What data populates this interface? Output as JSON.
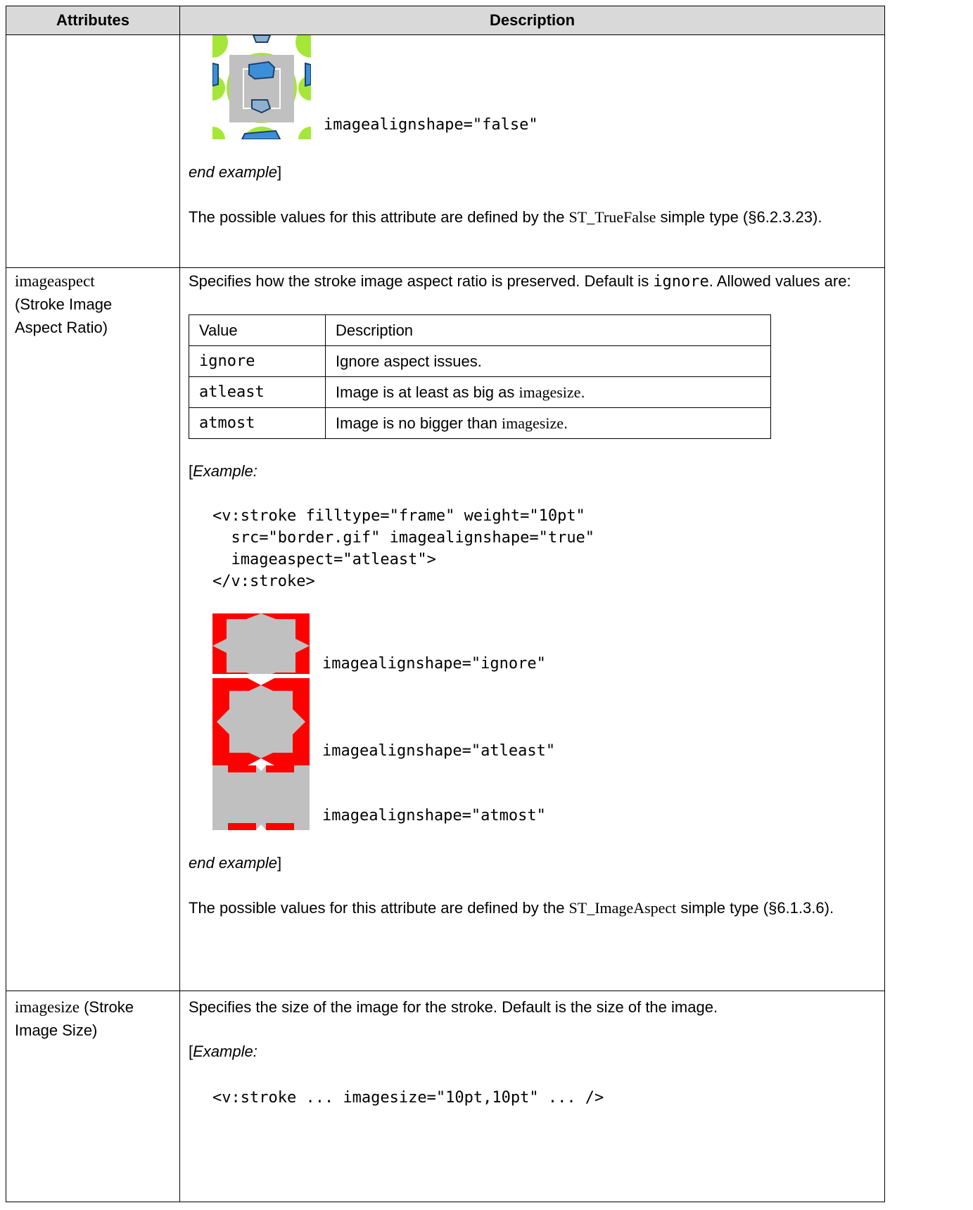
{
  "header": {
    "col_attributes": "Attributes",
    "col_description": "Description"
  },
  "row1": {
    "image_label": "imagealignshape=\"false\"",
    "end_example_italic": "end example",
    "end_example_bracket": "]",
    "possible_prefix": "The possible values for this attribute are defined by the ",
    "type_name": "ST_TrueFalse",
    "possible_suffix": " simple type (§6.2.3.23)."
  },
  "row2": {
    "attr_name": "imageaspect",
    "attr_sub": "(Stroke Image Aspect Ratio)",
    "desc_prefix": "Specifies how the stroke image aspect ratio is preserved.  Default is ",
    "desc_default": "ignore",
    "desc_suffix": ".  Allowed values are:",
    "values_table": {
      "head_value": "Value",
      "head_desc": "Description",
      "rows": [
        {
          "value": "ignore",
          "desc": "Ignore aspect issues."
        },
        {
          "value": "atleast",
          "desc_prefix": "Image is at least as big as ",
          "desc_term": "imagesize",
          "desc_suffix": "."
        },
        {
          "value": "atmost",
          "desc_prefix": "Image is no bigger than ",
          "desc_term": "imagesize",
          "desc_suffix": "."
        }
      ]
    },
    "example_open": "[",
    "example_italic": "Example:",
    "code": "<v:stroke filltype=\"frame\" weight=\"10pt\"\n  src=\"border.gif\" imagealignshape=\"true\"\n  imageaspect=\"atleast\">\n</v:stroke>",
    "image_labels": [
      "imagealignshape=\"ignore\"",
      "imagealignshape=\"atleast\"",
      "imagealignshape=\"atmost\""
    ],
    "end_example_italic": "end example",
    "end_example_bracket": "]",
    "possible_prefix": "The possible values for this attribute are defined by the ",
    "type_name": "ST_ImageAspect",
    "possible_suffix": " simple type (§6.1.3.6)."
  },
  "row3": {
    "attr_name": "imagesize",
    "attr_sub": "(Stroke Image Size)",
    "desc": "Specifies the size of the image for the stroke.  Default is the size of the image.",
    "example_open": "[",
    "example_italic": "Example:",
    "code": "<v:stroke ... imagesize=\"10pt,10pt\" ... />"
  },
  "colors": {
    "header_bg": "#d9d9d9",
    "red": "#ff0000",
    "gray": "#c0c0c0",
    "lime": "#a6e639"
  }
}
